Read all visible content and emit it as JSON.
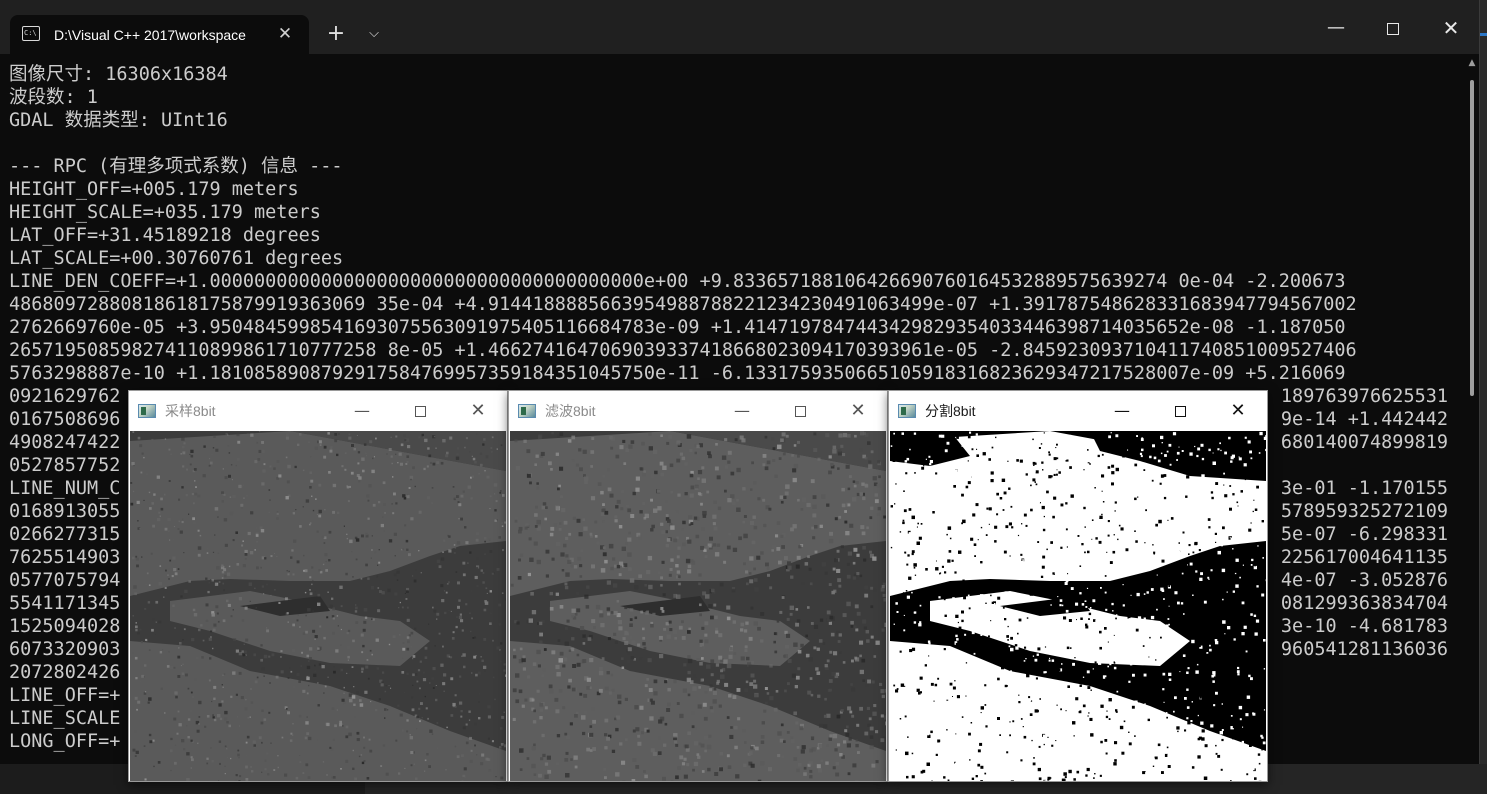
{
  "terminal": {
    "tab_title": "D:\\Visual C++ 2017\\workspace",
    "tab_icon": "console-icon",
    "new_tab_symbol": "+",
    "dropdown_symbol": "⌵",
    "minimize_symbol": "—",
    "close_symbol": "✕",
    "tab_close_symbol": "✕"
  },
  "console": {
    "lines": [
      "图像尺寸: 16306x16384",
      "波段数: 1",
      "GDAL 数据类型: UInt16",
      "",
      "--- RPC (有理多项式系数) 信息 ---",
      "HEIGHT_OFF=+005.179 meters",
      "HEIGHT_SCALE=+035.179 meters",
      "LAT_OFF=+31.45189218 degrees",
      "LAT_SCALE=+00.30760761 degrees",
      "LINE_DEN_COEFF=+1.000000000000000000000000000000000000000e+00 +9.833657188106426690760164532889575639274 0e-04 -2.200673",
      "48680972880818618175879919363069 35e-04 +4.9144188885663954988788221234230491063499e-07 +1.391787548628331683947794567002",
      "2762669760e-05 +3.9504845998541693075563091975405116684783e-09 +1.4147197847443429829354033446398714035652e-08 -1.187050",
      "265719508598274110899861710777258 8e-05 +1.4662741647069039337418668023094170393961e-05 -2.845923093710411740851009527406",
      "5763298887e-10 +1.1810858908792917584769957359184351045750e-11 -6.1331759350665105918316823629347217528007e-09 +5.216069",
      "0921629762",
      "0167508696",
      "4908247422",
      "0527857752",
      "LINE_NUM_C",
      "0168913055",
      "0266277315",
      "7625514903",
      "0577075794",
      "5541171345",
      "1525094028",
      "6073320903",
      "2072802426",
      "LINE_OFF=+",
      "LINE_SCALE",
      "LONG_OFF=+"
    ],
    "right_fragments": [
      "",
      "",
      "",
      "",
      "",
      "",
      "",
      "",
      "",
      "",
      "",
      "",
      "",
      "",
      "189763976625531",
      "9e-14 +1.442442",
      "680140074899819",
      "",
      "3e-01 -1.170155",
      "578959325272109",
      "5e-07 -6.298331",
      "225617004641135",
      "4e-07 -3.052876",
      "081299363834704",
      "3e-10 -4.681783",
      "960541281136036",
      "",
      "",
      "",
      ""
    ]
  },
  "windows": [
    {
      "title": "采样8bit",
      "icon": "opencv-window-icon",
      "kind": "gray",
      "active": false
    },
    {
      "title": "滤波8bit",
      "icon": "opencv-window-icon",
      "kind": "gray-smooth",
      "active": false
    },
    {
      "title": "分割8bit",
      "icon": "opencv-window-icon",
      "kind": "binary",
      "active": true
    }
  ],
  "colors": {
    "console_bg": "#0c0c0c",
    "console_text": "#cccccc",
    "titlebar_bg": "#202020"
  }
}
